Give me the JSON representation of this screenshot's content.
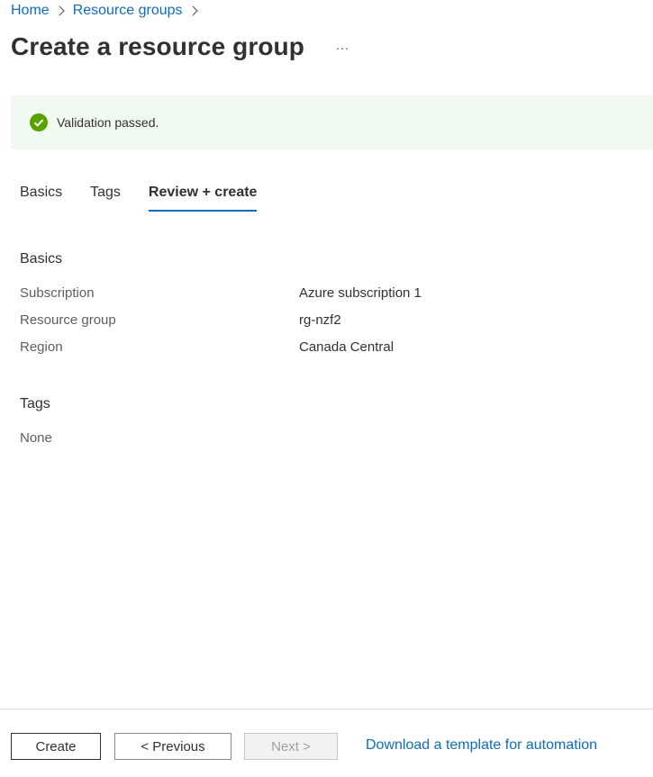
{
  "breadcrumb": {
    "home": "Home",
    "resource_groups": "Resource groups"
  },
  "page": {
    "title": "Create a resource group",
    "more_icon": "ellipsis-icon"
  },
  "banner": {
    "icon": "check-circle-icon",
    "text": "Validation passed.",
    "color": "#57a300"
  },
  "tabs": [
    {
      "label": "Basics",
      "active": false
    },
    {
      "label": "Tags",
      "active": false
    },
    {
      "label": "Review + create",
      "active": true
    }
  ],
  "basics": {
    "title": "Basics",
    "rows": [
      {
        "label": "Subscription",
        "value": "Azure subscription 1"
      },
      {
        "label": "Resource group",
        "value": "rg-nzf2"
      },
      {
        "label": "Region",
        "value": "Canada Central"
      }
    ]
  },
  "tags_section": {
    "title": "Tags",
    "value": "None"
  },
  "footer": {
    "create_label": "Create",
    "previous_label": "< Previous",
    "next_label": "Next >",
    "download_label": "Download a template for automation"
  },
  "colors": {
    "accent": "#0f6cbd",
    "banner_bg": "#f1faf1"
  }
}
